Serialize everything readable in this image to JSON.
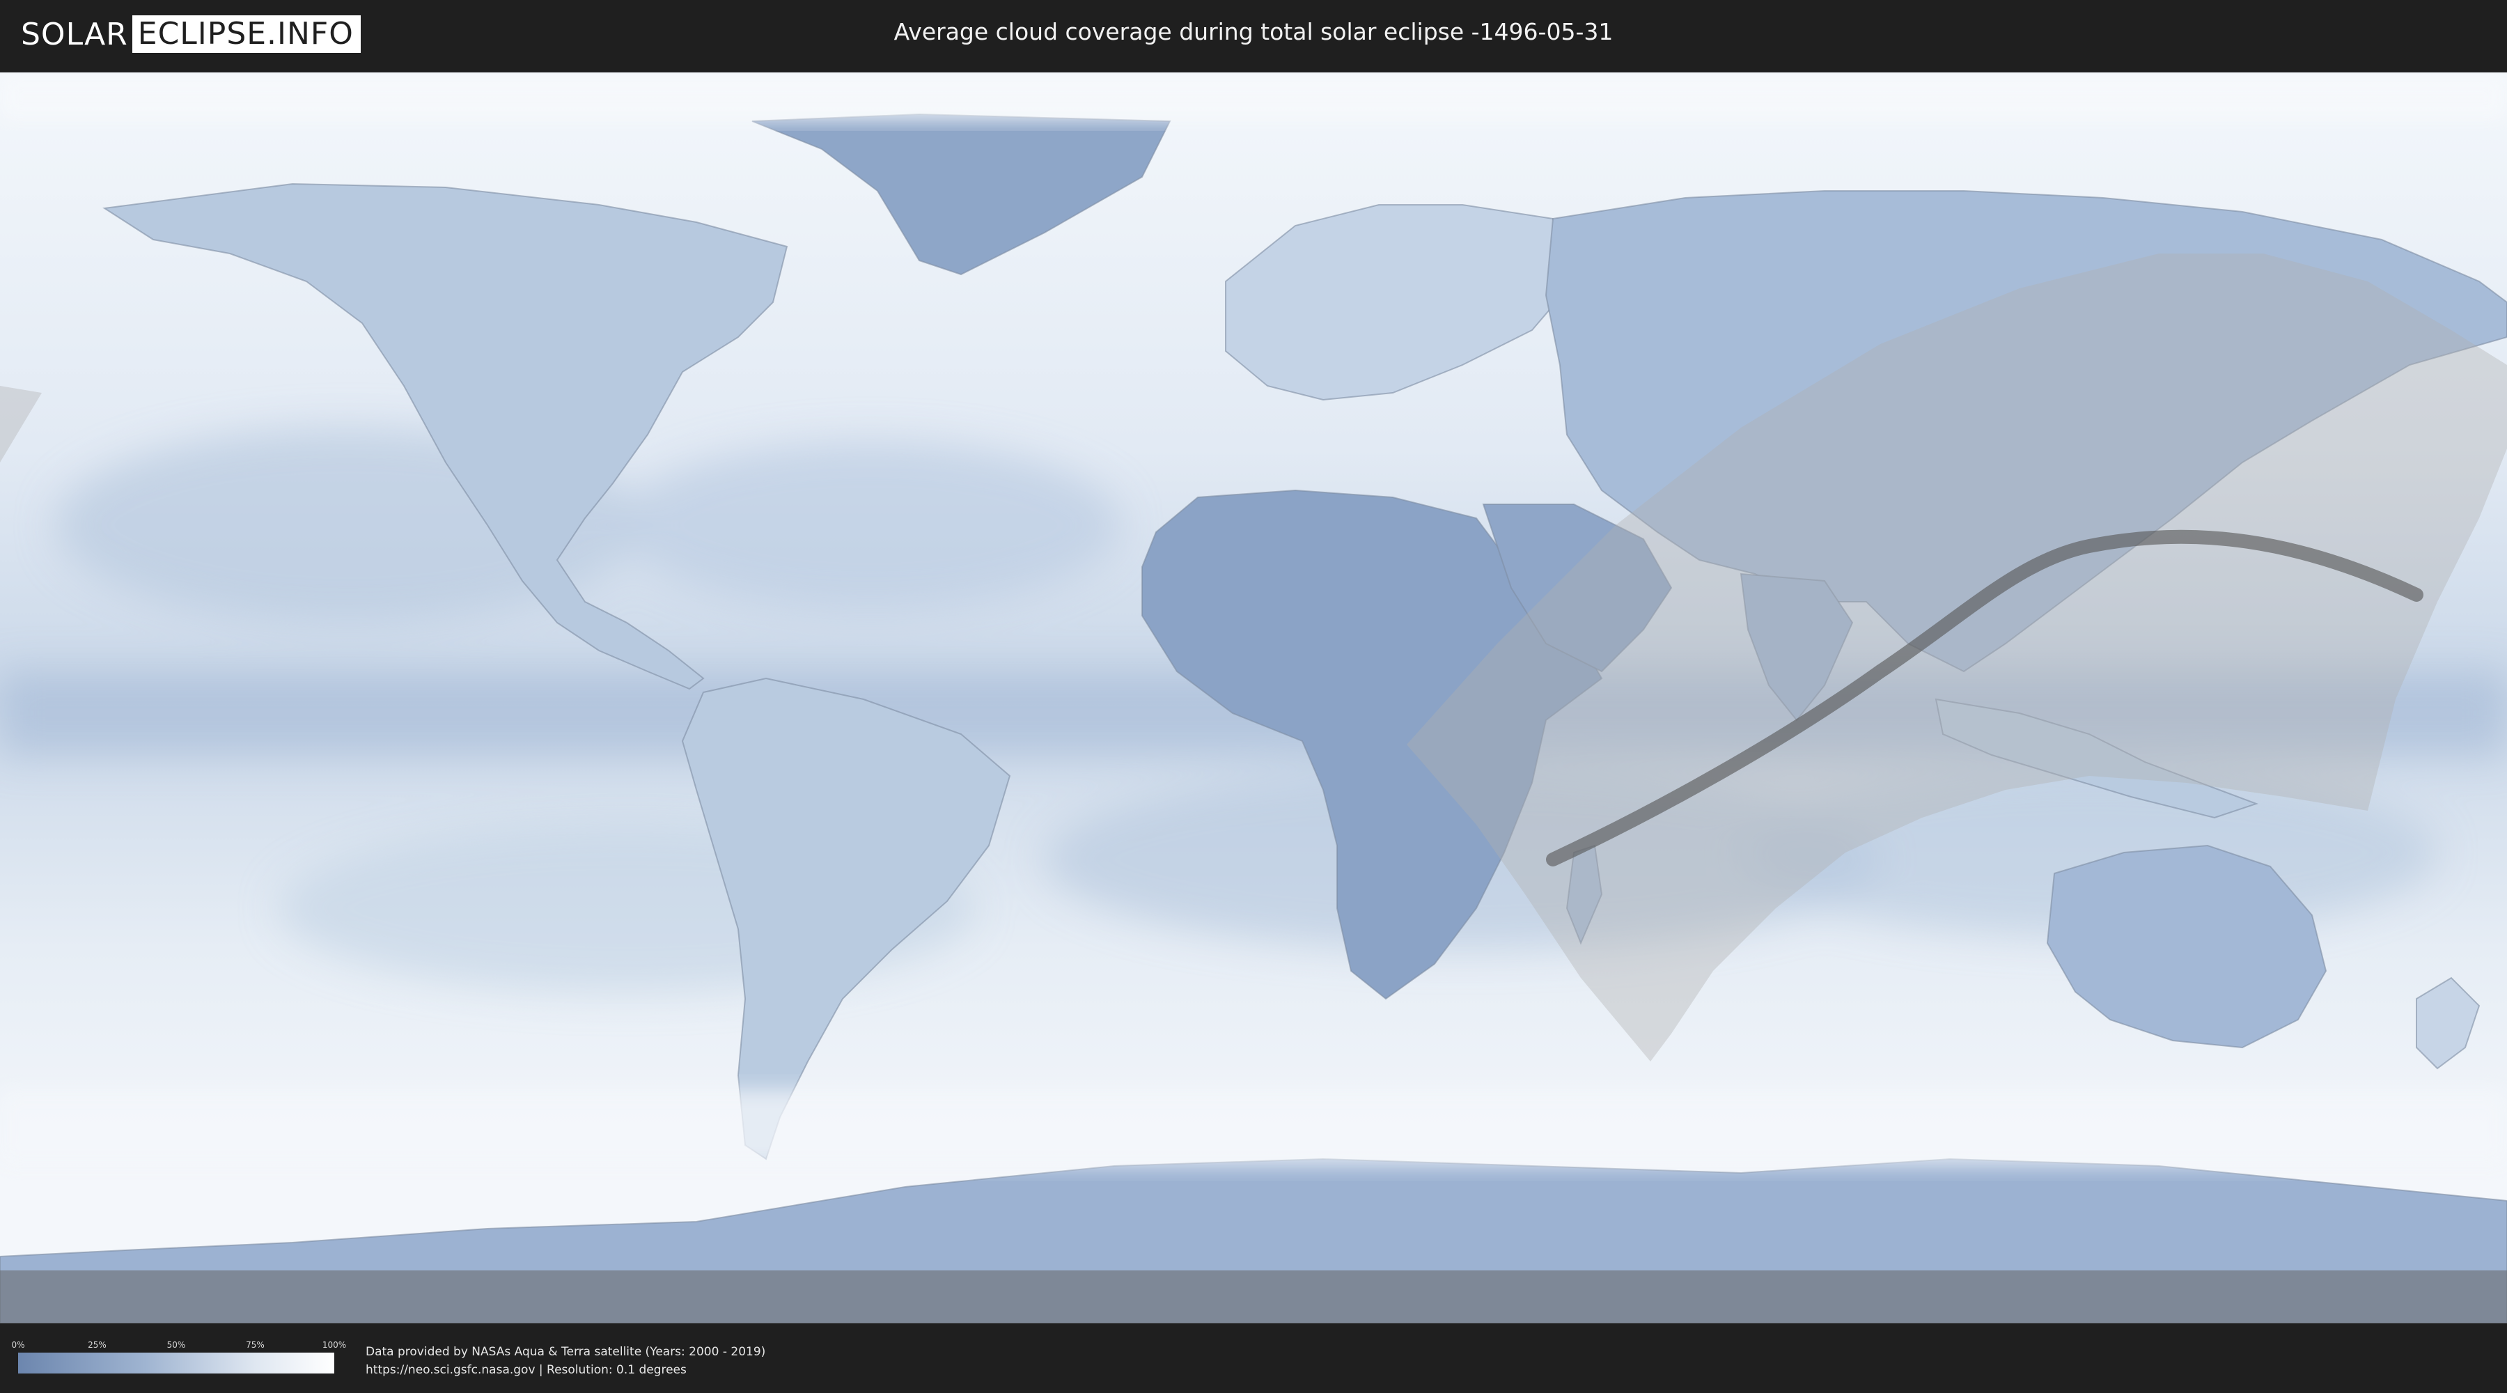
{
  "header": {
    "logo_left": "SOLAR",
    "logo_right": "ECLIPSE.INFO",
    "title": "Average cloud coverage during total solar eclipse -1496-05-31"
  },
  "legend": {
    "ticks": [
      "0%",
      "25%",
      "50%",
      "75%",
      "100%"
    ],
    "colors": {
      "low": "#6c86ae",
      "high": "#ffffff"
    }
  },
  "credits": {
    "line1": "Data provided by NASAs Aqua & Terra satellite (Years: 2000 - 2019)",
    "line2": "https://neo.sci.gsfc.nasa.gov | Resolution: 0.1 degrees"
  },
  "map": {
    "ocean_color": "#e4ecf5",
    "cloud_dark_color": "#5d7aa6",
    "eclipse_zone_color": "#b8b8b8",
    "eclipse_path_color": "#555555"
  }
}
